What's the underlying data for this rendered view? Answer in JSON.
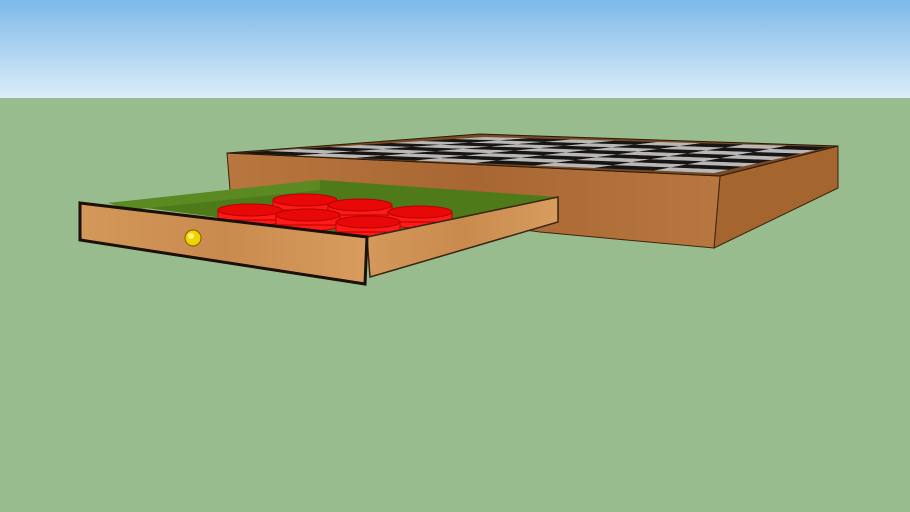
{
  "scene": {
    "colors": {
      "sky_top": "#7db9ea",
      "sky_horizon": "#dcedf8",
      "ground": "#98bc8d",
      "wood_light": "#c98a4e",
      "wood_dark": "#9e5f30",
      "felt": "#4e7a1a",
      "chip": "#e80808",
      "chip_dark": "#b50000",
      "knob": "#f2d200",
      "board_dark": "#151515",
      "board_light": "#b8b8b8"
    },
    "checker": {
      "rows": 8,
      "cols": 8
    }
  }
}
